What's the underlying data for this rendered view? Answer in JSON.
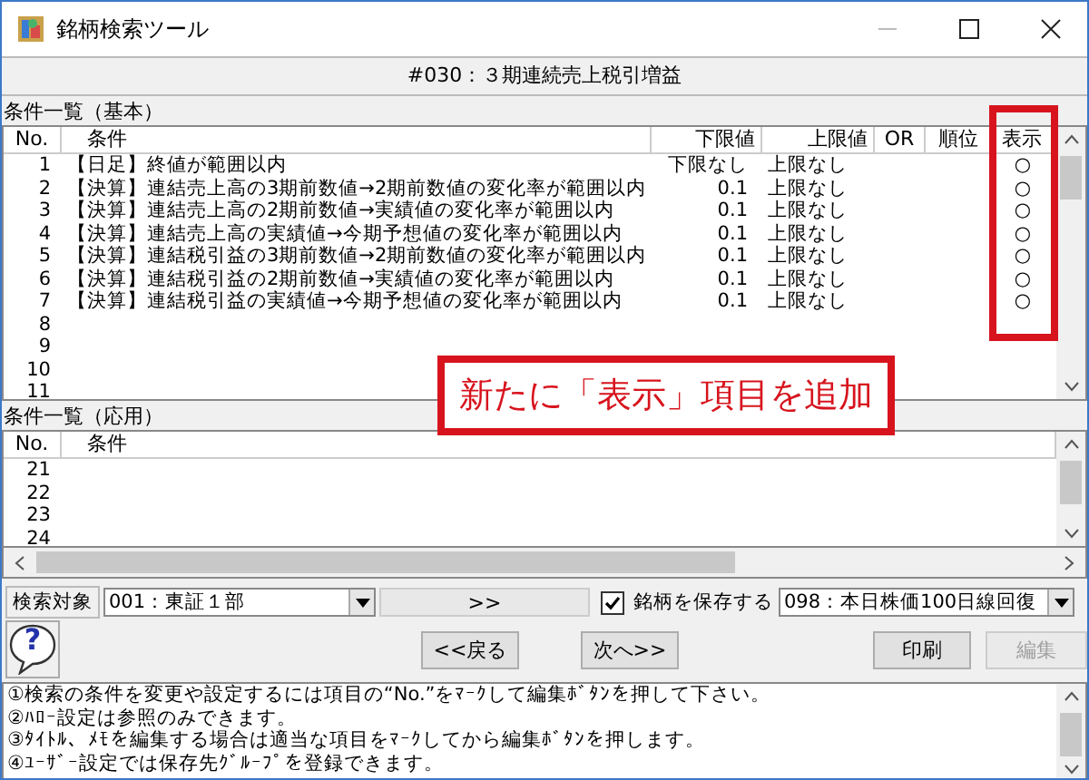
{
  "window": {
    "title": "銘柄検索ツール"
  },
  "heading": "#030：３期連続売上税引増益",
  "basic": {
    "label": "条件一覧（基本）",
    "columns": [
      "No.",
      "条件",
      "下限値",
      "上限値",
      "OR",
      "順位",
      "表示"
    ],
    "rows": [
      {
        "no": "1",
        "condition": "【日足】終値が範囲以内",
        "lower": "下限なし",
        "upper": "上限なし",
        "display": "○"
      },
      {
        "no": "2",
        "condition": "【決算】連結売上高の3期前数値→2期前数値の変化率が範囲以内",
        "lower": "0.1",
        "upper": "上限なし",
        "display": "○"
      },
      {
        "no": "3",
        "condition": "【決算】連結売上高の2期前数値→実績値の変化率が範囲以内",
        "lower": "0.1",
        "upper": "上限なし",
        "display": "○"
      },
      {
        "no": "4",
        "condition": "【決算】連結売上高の実績値→今期予想値の変化率が範囲以内",
        "lower": "0.1",
        "upper": "上限なし",
        "display": "○"
      },
      {
        "no": "5",
        "condition": "【決算】連結税引益の3期前数値→2期前数値の変化率が範囲以内",
        "lower": "0.1",
        "upper": "上限なし",
        "display": "○"
      },
      {
        "no": "6",
        "condition": "【決算】連結税引益の2期前数値→実績値の変化率が範囲以内",
        "lower": "0.1",
        "upper": "上限なし",
        "display": "○"
      },
      {
        "no": "7",
        "condition": "【決算】連結税引益の実績値→今期予想値の変化率が範囲以内",
        "lower": "0.1",
        "upper": "上限なし",
        "display": "○"
      },
      {
        "no": "8"
      },
      {
        "no": "9"
      },
      {
        "no": "10"
      },
      {
        "no": "11"
      }
    ]
  },
  "applied": {
    "label": "条件一覧（応用）",
    "columns": [
      "No.",
      "条件"
    ],
    "rows": [
      {
        "no": "21"
      },
      {
        "no": "22"
      },
      {
        "no": "23"
      },
      {
        "no": "24"
      }
    ]
  },
  "search_target": {
    "label": "検索対象",
    "value": "001：東証１部"
  },
  "more_button": ">>",
  "save": {
    "label": "銘柄を保存する",
    "checked": true,
    "value": "098：本日株価100日線回復"
  },
  "help": "?",
  "buttons": [
    {
      "label": "<<戻る",
      "disabled": false
    },
    {
      "label": "次へ>>",
      "disabled": false
    },
    {
      "label": "印刷",
      "disabled": false
    },
    {
      "label": "編集",
      "disabled": true
    }
  ],
  "notes": [
    "①検索の条件を変更や設定するには項目の“No.”をﾏｰｸして編集ﾎﾞﾀﾝを押して下さい。",
    "②ﾊﾛｰ設定は参照のみできます。",
    "③ﾀｲﾄﾙ、ﾒﾓを編集する場合は適当な項目をﾏｰｸしてから編集ﾎﾞﾀﾝを押します。",
    "④ﾕｰｻﾞｰ設定では保存先ｸﾞﾙｰﾌﾟを登録できます。"
  ],
  "annotation": {
    "text": "新たに「表示」項目を追加"
  }
}
